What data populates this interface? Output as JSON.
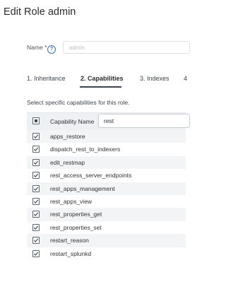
{
  "page": {
    "title": "Edit Role admin"
  },
  "form": {
    "name_label": "Name *",
    "name_help_icon": "question-icon",
    "name_value": "admin"
  },
  "tabs": [
    {
      "label": "1. Inheritance",
      "active": false
    },
    {
      "label": "2. Capabilities",
      "active": true
    },
    {
      "label": "3. Indexes",
      "active": false
    },
    {
      "label": "4",
      "active": false
    }
  ],
  "capabilities": {
    "hint": "Select specific capabilities for this role.",
    "column_header": "Capability Name",
    "filter_value": "rest",
    "header_checkbox_state": "partial",
    "rows": [
      {
        "name": "apps_restore",
        "checked": true
      },
      {
        "name": "dispatch_rest_to_indexers",
        "checked": true
      },
      {
        "name": "edit_restmap",
        "checked": true
      },
      {
        "name": "rest_access_server_endpoints",
        "checked": true
      },
      {
        "name": "rest_apps_management",
        "checked": true
      },
      {
        "name": "rest_apps_view",
        "checked": true
      },
      {
        "name": "rest_properties_get",
        "checked": true
      },
      {
        "name": "rest_properties_set",
        "checked": true
      },
      {
        "name": "restart_reason",
        "checked": true
      },
      {
        "name": "restart_splunkd",
        "checked": true
      }
    ]
  },
  "colors": {
    "accent": "#3c444d",
    "header_bg": "#eef1f3",
    "row_alt_bg": "#f2f4f5",
    "help_icon": "#3a6fa8"
  }
}
